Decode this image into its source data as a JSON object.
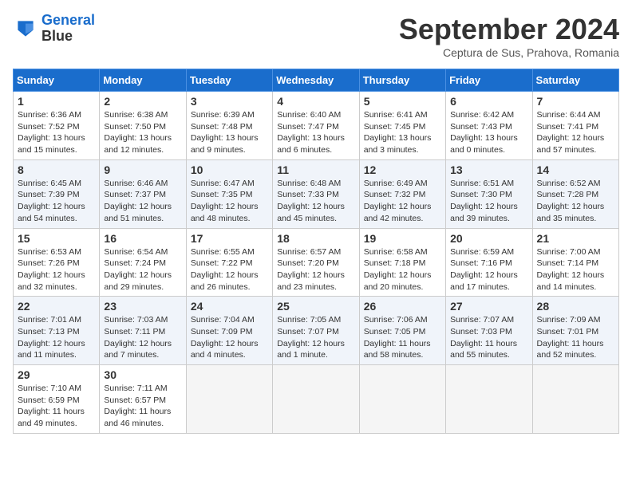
{
  "logo": {
    "line1": "General",
    "line2": "Blue"
  },
  "title": "September 2024",
  "location": "Ceptura de Sus, Prahova, Romania",
  "headers": [
    "Sunday",
    "Monday",
    "Tuesday",
    "Wednesday",
    "Thursday",
    "Friday",
    "Saturday"
  ],
  "weeks": [
    [
      {
        "day": "1",
        "sunrise": "6:36 AM",
        "sunset": "7:52 PM",
        "daylight": "13 hours and 15 minutes."
      },
      {
        "day": "2",
        "sunrise": "6:38 AM",
        "sunset": "7:50 PM",
        "daylight": "13 hours and 12 minutes."
      },
      {
        "day": "3",
        "sunrise": "6:39 AM",
        "sunset": "7:48 PM",
        "daylight": "13 hours and 9 minutes."
      },
      {
        "day": "4",
        "sunrise": "6:40 AM",
        "sunset": "7:47 PM",
        "daylight": "13 hours and 6 minutes."
      },
      {
        "day": "5",
        "sunrise": "6:41 AM",
        "sunset": "7:45 PM",
        "daylight": "13 hours and 3 minutes."
      },
      {
        "day": "6",
        "sunrise": "6:42 AM",
        "sunset": "7:43 PM",
        "daylight": "13 hours and 0 minutes."
      },
      {
        "day": "7",
        "sunrise": "6:44 AM",
        "sunset": "7:41 PM",
        "daylight": "12 hours and 57 minutes."
      }
    ],
    [
      {
        "day": "8",
        "sunrise": "6:45 AM",
        "sunset": "7:39 PM",
        "daylight": "12 hours and 54 minutes."
      },
      {
        "day": "9",
        "sunrise": "6:46 AM",
        "sunset": "7:37 PM",
        "daylight": "12 hours and 51 minutes."
      },
      {
        "day": "10",
        "sunrise": "6:47 AM",
        "sunset": "7:35 PM",
        "daylight": "12 hours and 48 minutes."
      },
      {
        "day": "11",
        "sunrise": "6:48 AM",
        "sunset": "7:33 PM",
        "daylight": "12 hours and 45 minutes."
      },
      {
        "day": "12",
        "sunrise": "6:49 AM",
        "sunset": "7:32 PM",
        "daylight": "12 hours and 42 minutes."
      },
      {
        "day": "13",
        "sunrise": "6:51 AM",
        "sunset": "7:30 PM",
        "daylight": "12 hours and 39 minutes."
      },
      {
        "day": "14",
        "sunrise": "6:52 AM",
        "sunset": "7:28 PM",
        "daylight": "12 hours and 35 minutes."
      }
    ],
    [
      {
        "day": "15",
        "sunrise": "6:53 AM",
        "sunset": "7:26 PM",
        "daylight": "12 hours and 32 minutes."
      },
      {
        "day": "16",
        "sunrise": "6:54 AM",
        "sunset": "7:24 PM",
        "daylight": "12 hours and 29 minutes."
      },
      {
        "day": "17",
        "sunrise": "6:55 AM",
        "sunset": "7:22 PM",
        "daylight": "12 hours and 26 minutes."
      },
      {
        "day": "18",
        "sunrise": "6:57 AM",
        "sunset": "7:20 PM",
        "daylight": "12 hours and 23 minutes."
      },
      {
        "day": "19",
        "sunrise": "6:58 AM",
        "sunset": "7:18 PM",
        "daylight": "12 hours and 20 minutes."
      },
      {
        "day": "20",
        "sunrise": "6:59 AM",
        "sunset": "7:16 PM",
        "daylight": "12 hours and 17 minutes."
      },
      {
        "day": "21",
        "sunrise": "7:00 AM",
        "sunset": "7:14 PM",
        "daylight": "12 hours and 14 minutes."
      }
    ],
    [
      {
        "day": "22",
        "sunrise": "7:01 AM",
        "sunset": "7:13 PM",
        "daylight": "12 hours and 11 minutes."
      },
      {
        "day": "23",
        "sunrise": "7:03 AM",
        "sunset": "7:11 PM",
        "daylight": "12 hours and 7 minutes."
      },
      {
        "day": "24",
        "sunrise": "7:04 AM",
        "sunset": "7:09 PM",
        "daylight": "12 hours and 4 minutes."
      },
      {
        "day": "25",
        "sunrise": "7:05 AM",
        "sunset": "7:07 PM",
        "daylight": "12 hours and 1 minute."
      },
      {
        "day": "26",
        "sunrise": "7:06 AM",
        "sunset": "7:05 PM",
        "daylight": "11 hours and 58 minutes."
      },
      {
        "day": "27",
        "sunrise": "7:07 AM",
        "sunset": "7:03 PM",
        "daylight": "11 hours and 55 minutes."
      },
      {
        "day": "28",
        "sunrise": "7:09 AM",
        "sunset": "7:01 PM",
        "daylight": "11 hours and 52 minutes."
      }
    ],
    [
      {
        "day": "29",
        "sunrise": "7:10 AM",
        "sunset": "6:59 PM",
        "daylight": "11 hours and 49 minutes."
      },
      {
        "day": "30",
        "sunrise": "7:11 AM",
        "sunset": "6:57 PM",
        "daylight": "11 hours and 46 minutes."
      },
      null,
      null,
      null,
      null,
      null
    ]
  ]
}
